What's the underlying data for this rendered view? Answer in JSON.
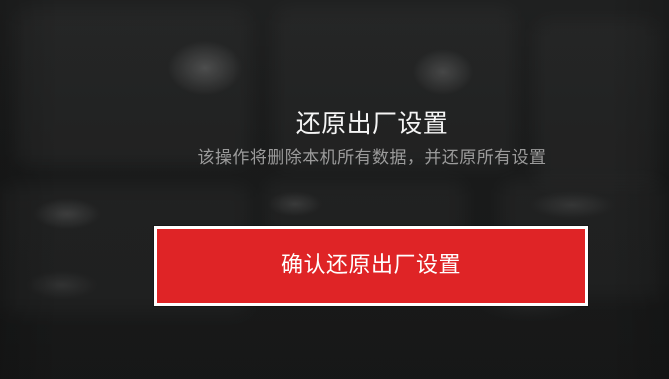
{
  "reset_dialog": {
    "title": "还原出厂设置",
    "warning_text": "该操作将删除本机所有数据，并还原所有设置",
    "confirm_button_label": "确认还原出厂设置"
  },
  "colors": {
    "background": "#1a1b1b",
    "primary_text": "#f5f5f5",
    "secondary_text": "#9b9b9b",
    "danger_button": "#df2426",
    "button_border": "#ffffff"
  }
}
